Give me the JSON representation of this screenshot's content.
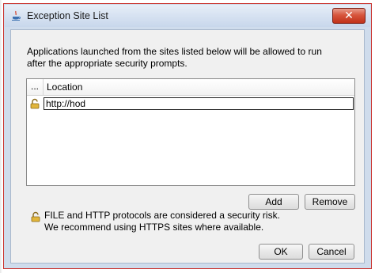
{
  "window": {
    "title": "Exception Site List",
    "close_label": "✕"
  },
  "description": "Applications launched from the sites listed below will be allowed to run after the appropriate security prompts.",
  "table": {
    "columns": [
      "...",
      "Location"
    ],
    "rows": [
      {
        "icon": "padlock-icon",
        "location": "http://hod"
      }
    ]
  },
  "buttons": {
    "add": "Add",
    "remove": "Remove",
    "ok": "OK",
    "cancel": "Cancel"
  },
  "warning": {
    "icon": "padlock-warning-icon",
    "line1": "FILE and HTTP protocols are considered a security risk.",
    "line2": "We recommend using HTTPS sites where available."
  },
  "colors": {
    "title_bar": "#d5e1f1",
    "close_button": "#c0321a",
    "dialog_background": "#f0f0f0"
  }
}
